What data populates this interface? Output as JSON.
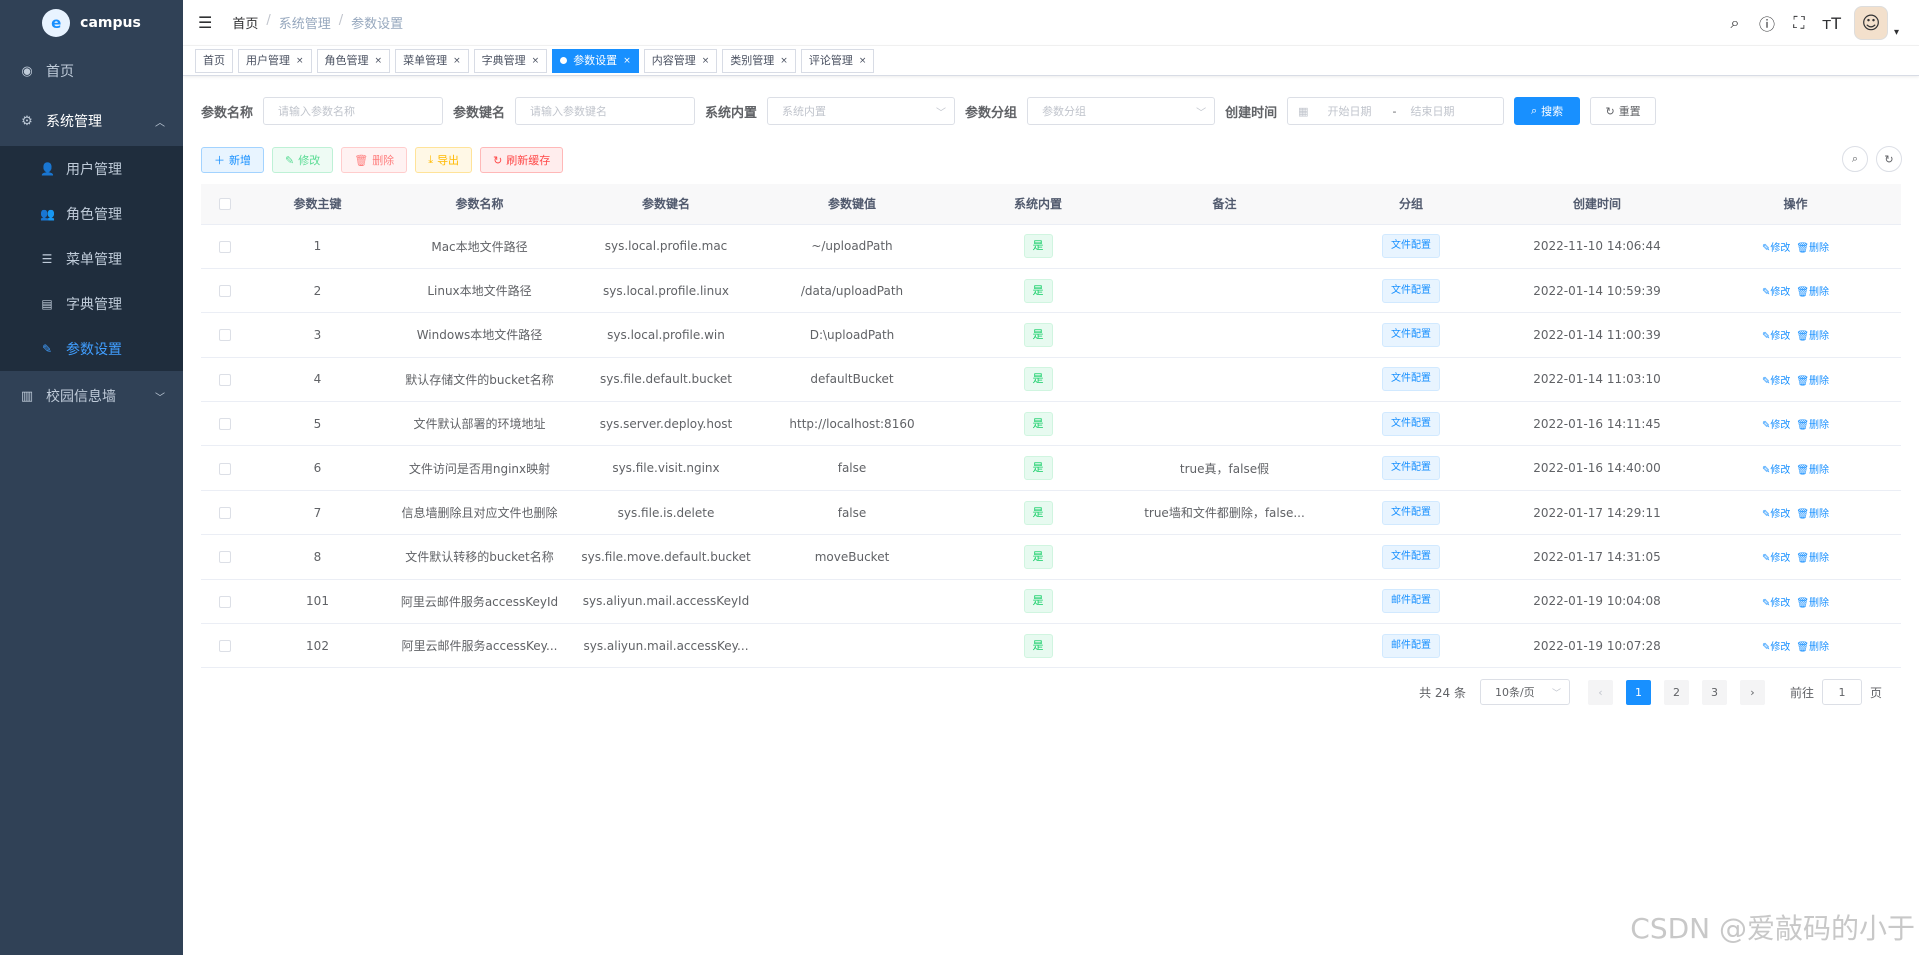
{
  "app": {
    "name": "campus",
    "logo_letter": "e"
  },
  "sidebar": {
    "home": "首页",
    "system": "系统管理",
    "sub": [
      "用户管理",
      "角色管理",
      "菜单管理",
      "字典管理",
      "参数设置"
    ],
    "campus_wall": "校园信息墙"
  },
  "breadcrumb": [
    "首页",
    "系统管理",
    "参数设置"
  ],
  "tags": [
    "首页",
    "用户管理",
    "角色管理",
    "菜单管理",
    "字典管理",
    "参数设置",
    "内容管理",
    "类别管理",
    "评论管理"
  ],
  "search": {
    "name_label": "参数名称",
    "name_placeholder": "请输入参数名称",
    "key_label": "参数键名",
    "key_placeholder": "请输入参数键名",
    "builtin_label": "系统内置",
    "builtin_placeholder": "系统内置",
    "group_label": "参数分组",
    "group_placeholder": "参数分组",
    "time_label": "创建时间",
    "start_placeholder": "开始日期",
    "range_sep": "-",
    "end_placeholder": "结束日期",
    "search_btn": "搜索",
    "reset_btn": "重置"
  },
  "toolbar": {
    "add": "新增",
    "edit": "修改",
    "delete": "删除",
    "export": "导出",
    "refresh_cache": "刷新缓存"
  },
  "table": {
    "headers": [
      "参数主键",
      "参数名称",
      "参数键名",
      "参数键值",
      "系统内置",
      "备注",
      "分组",
      "创建时间",
      "操作"
    ],
    "rows": [
      {
        "id": "1",
        "name": "Mac本地文件路径",
        "key": "sys.local.profile.mac",
        "value": "~/uploadPath",
        "builtin": "是",
        "remark": "",
        "group": "文件配置",
        "time": "2022-11-10 14:06:44"
      },
      {
        "id": "2",
        "name": "Linux本地文件路径",
        "key": "sys.local.profile.linux",
        "value": "/data/uploadPath",
        "builtin": "是",
        "remark": "",
        "group": "文件配置",
        "time": "2022-01-14 10:59:39"
      },
      {
        "id": "3",
        "name": "Windows本地文件路径",
        "key": "sys.local.profile.win",
        "value": "D:\\uploadPath",
        "builtin": "是",
        "remark": "",
        "group": "文件配置",
        "time": "2022-01-14 11:00:39"
      },
      {
        "id": "4",
        "name": "默认存储文件的bucket名称",
        "key": "sys.file.default.bucket",
        "value": "defaultBucket",
        "builtin": "是",
        "remark": "",
        "group": "文件配置",
        "time": "2022-01-14 11:03:10"
      },
      {
        "id": "5",
        "name": "文件默认部署的环境地址",
        "key": "sys.server.deploy.host",
        "value": "http://localhost:8160",
        "builtin": "是",
        "remark": "",
        "group": "文件配置",
        "time": "2022-01-16 14:11:45"
      },
      {
        "id": "6",
        "name": "文件访问是否用nginx映射",
        "key": "sys.file.visit.nginx",
        "value": "false",
        "builtin": "是",
        "remark": "true真，false假",
        "group": "文件配置",
        "time": "2022-01-16 14:40:00"
      },
      {
        "id": "7",
        "name": "信息墙删除且对应文件也删除",
        "key": "sys.file.is.delete",
        "value": "false",
        "builtin": "是",
        "remark": "true墙和文件都删除，false...",
        "group": "文件配置",
        "time": "2022-01-17 14:29:11"
      },
      {
        "id": "8",
        "name": "文件默认转移的bucket名称",
        "key": "sys.file.move.default.bucket",
        "value": "moveBucket",
        "builtin": "是",
        "remark": "",
        "group": "文件配置",
        "time": "2022-01-17 14:31:05"
      },
      {
        "id": "101",
        "name": "阿里云邮件服务accessKeyId",
        "key": "sys.aliyun.mail.accessKeyId",
        "value": "",
        "builtin": "是",
        "remark": "",
        "group": "邮件配置",
        "time": "2022-01-19 10:04:08"
      },
      {
        "id": "102",
        "name": "阿里云邮件服务accessKey...",
        "key": "sys.aliyun.mail.accessKey...",
        "value": "",
        "builtin": "是",
        "remark": "",
        "group": "邮件配置",
        "time": "2022-01-19 10:07:28"
      }
    ],
    "op_edit": "修改",
    "op_delete": "删除"
  },
  "pagination": {
    "total": "共 24 条",
    "page_size": "10条/页",
    "pages": [
      "1",
      "2",
      "3"
    ],
    "current": "1",
    "goto_label": "前往",
    "goto_value": "1",
    "goto_suffix": "页"
  },
  "watermark": "CSDN @爱敲码的小于"
}
